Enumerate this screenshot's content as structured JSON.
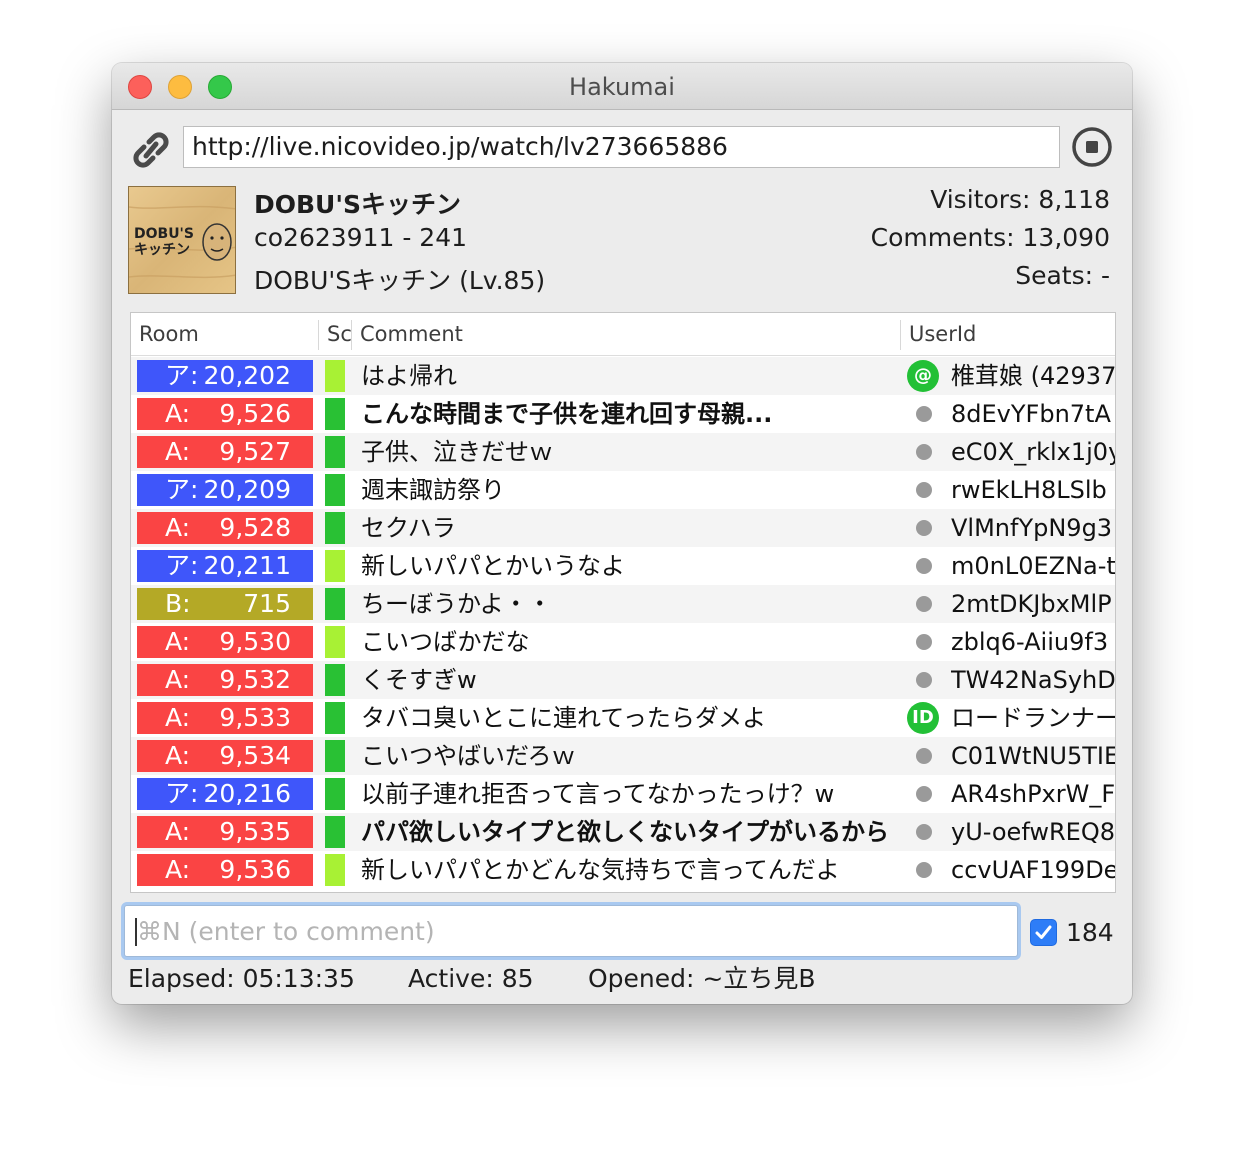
{
  "window": {
    "title": "Hakumai"
  },
  "url_bar": {
    "value": "http://live.nicovideo.jp/watch/lv273665886"
  },
  "broadcast": {
    "title": "DOBU'Sキッチン",
    "id_line": "co2623911 - 241",
    "community_line": "DOBU'Sキッチン (Lv.85)",
    "thumbnail_text": "DOBU'S キッチン"
  },
  "stats": {
    "visitors": "Visitors: 8,118",
    "comments": "Comments: 13,090",
    "seats": "Seats: -"
  },
  "columns": {
    "room": "Room",
    "score": "Sc",
    "comment": "Comment",
    "userid": "UserId"
  },
  "colors": {
    "room_arena": "#3f56fa",
    "room_a": "#fa4444",
    "room_b": "#b4a926",
    "score_light": "#a8f134",
    "score_green": "#29c134",
    "user_icon": "#22c036",
    "dot": "#9a9a9a"
  },
  "rows": [
    {
      "room_label": "ア:",
      "room_no": "20,202",
      "room_type": "arena",
      "score": "light",
      "comment": "はよ帰れ",
      "bold": false,
      "user_icon": "at",
      "user_icon_text": "@",
      "userid": "椎茸娘 (42937"
    },
    {
      "room_label": "A:",
      "room_no": "9,526",
      "room_type": "a",
      "score": "green",
      "comment": "こんな時間まで子供を連れ回す母親...",
      "bold": true,
      "user_icon": "dot",
      "userid": "8dEvYFbn7tA"
    },
    {
      "room_label": "A:",
      "room_no": "9,527",
      "room_type": "a",
      "score": "green",
      "comment": "子供、泣きだせｗ",
      "bold": false,
      "user_icon": "dot",
      "userid": "eC0X_rklx1j0y"
    },
    {
      "room_label": "ア:",
      "room_no": "20,209",
      "room_type": "arena",
      "score": "green",
      "comment": "週末諏訪祭り",
      "bold": false,
      "user_icon": "dot",
      "userid": "rwEkLH8LSlb"
    },
    {
      "room_label": "A:",
      "room_no": "9,528",
      "room_type": "a",
      "score": "green",
      "comment": "セクハラ",
      "bold": false,
      "user_icon": "dot",
      "userid": "VlMnfYpN9g3"
    },
    {
      "room_label": "ア:",
      "room_no": "20,211",
      "room_type": "arena",
      "score": "light",
      "comment": "新しいパパとかいうなよ",
      "bold": false,
      "user_icon": "dot",
      "userid": "m0nL0EZNa-t"
    },
    {
      "room_label": "B:",
      "room_no": "715",
      "room_type": "b",
      "score": "green",
      "comment": "ちーぼうかよ・・",
      "bold": false,
      "user_icon": "dot",
      "userid": "2mtDKJbxMlP"
    },
    {
      "room_label": "A:",
      "room_no": "9,530",
      "room_type": "a",
      "score": "light",
      "comment": "こいつばかだな",
      "bold": false,
      "user_icon": "dot",
      "userid": "zblq6-Aiiu9f3"
    },
    {
      "room_label": "A:",
      "room_no": "9,532",
      "room_type": "a",
      "score": "green",
      "comment": "くそすぎw",
      "bold": false,
      "user_icon": "dot",
      "userid": "TW42NaSyhD"
    },
    {
      "room_label": "A:",
      "room_no": "9,533",
      "room_type": "a",
      "score": "green",
      "comment": "タバコ臭いとこに連れてったらダメよ",
      "bold": false,
      "user_icon": "id",
      "user_icon_text": "ID",
      "userid": "ロードランナー"
    },
    {
      "room_label": "A:",
      "room_no": "9,534",
      "room_type": "a",
      "score": "green",
      "comment": "こいつやばいだろｗ",
      "bold": false,
      "user_icon": "dot",
      "userid": "C01WtNU5TIE"
    },
    {
      "room_label": "ア:",
      "room_no": "20,216",
      "room_type": "arena",
      "score": "green",
      "comment": "以前子連れ拒否って言ってなかったっけ？w",
      "bold": false,
      "user_icon": "dot",
      "userid": "AR4shPxrW_F"
    },
    {
      "room_label": "A:",
      "room_no": "9,535",
      "room_type": "a",
      "score": "green",
      "comment": "パパ欲しいタイプと欲しくないタイプがいるから",
      "bold": true,
      "user_icon": "dot",
      "userid": "yU-oefwREQ8"
    },
    {
      "room_label": "A:",
      "room_no": "9,536",
      "room_type": "a",
      "score": "light",
      "comment": "新しいパパとかどんな気持ちで言ってんだよ",
      "bold": false,
      "user_icon": "dot",
      "userid": "ccvUAF199De"
    }
  ],
  "comment_input": {
    "placeholder": "⌘N (enter to comment)",
    "value": ""
  },
  "checkbox_184": {
    "checked": true,
    "label": "184"
  },
  "status": {
    "elapsed": "Elapsed: 05:13:35",
    "active": "Active: 85",
    "opened": "Opened: ~立ち見B"
  },
  "icons": [
    "link-icon",
    "stop-icon"
  ]
}
